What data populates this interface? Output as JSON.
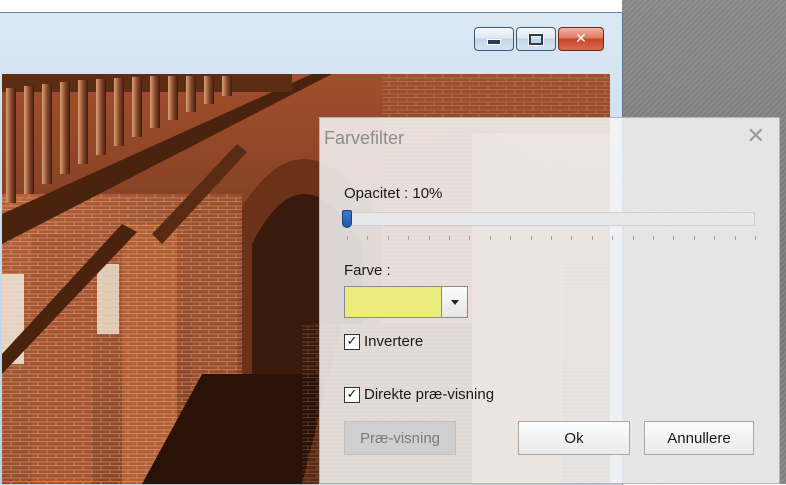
{
  "dialog": {
    "title": "Farvefilter",
    "opacity_label": "Opacitet : 10%",
    "opacity_value_percent": 10,
    "color_label": "Farve :",
    "selected_color": "#ecec7e",
    "invert_label": "Invertere",
    "invert_checked": true,
    "live_preview_label": "Direkte præ-visning",
    "live_preview_checked": true,
    "preview_button": "Præ-visning",
    "ok_button": "Ok",
    "cancel_button": "Annullere"
  },
  "icons": {
    "minimize": "minimize-icon",
    "maximize": "maximize-icon",
    "close": "close-icon",
    "dialog_close": "close-icon",
    "dropdown": "chevron-down-icon",
    "check": "check-icon"
  }
}
